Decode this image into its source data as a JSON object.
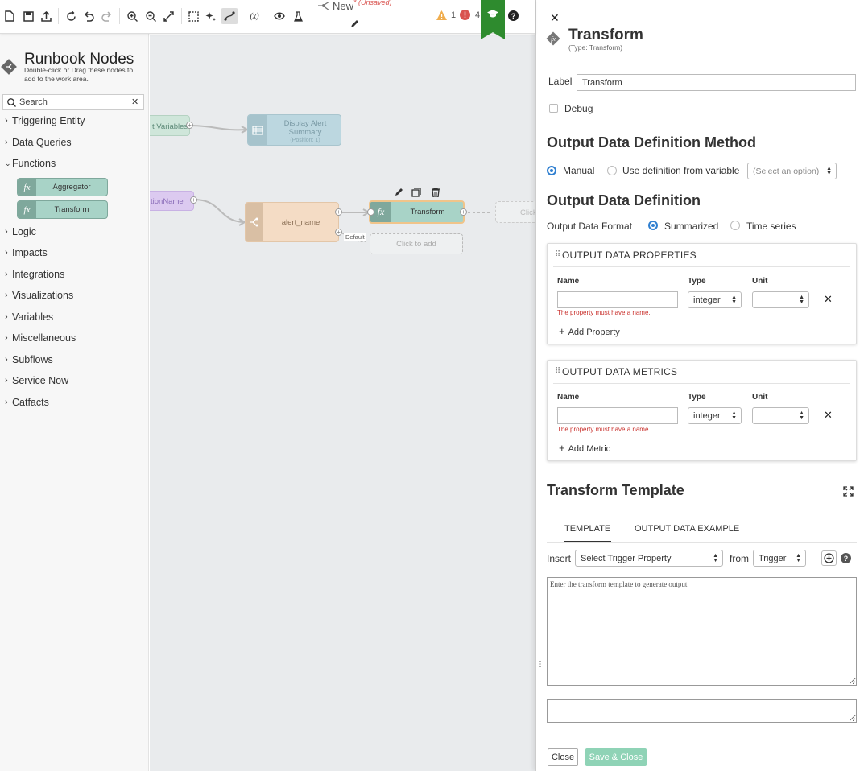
{
  "toolbar": {
    "flow_title": "New",
    "unsaved_label": "(Unsaved)",
    "warning_count": "1",
    "error_count": "4",
    "warning_color": "#f0ad4e",
    "error_color": "#d9534f",
    "learn_color": "#2e8b2e",
    "icons": [
      "new-file-icon",
      "save-icon",
      "export-icon",
      "refresh-icon",
      "undo-icon",
      "redo-icon",
      "zoom-in-icon",
      "zoom-out-icon",
      "fit-screen-icon",
      "select-area-icon",
      "auto-layout-icon",
      "connector-icon",
      "variables-icon",
      "preview-icon",
      "test-icon",
      "learn-icon",
      "help-icon"
    ]
  },
  "sidebar": {
    "title": "Runbook Nodes",
    "subtitle": "Double-click or Drag these nodes to add to the work area.",
    "search_placeholder": "Search",
    "categories": [
      {
        "label": "Triggering Entity",
        "expanded": false
      },
      {
        "label": "Data Queries",
        "expanded": false
      },
      {
        "label": "Functions",
        "expanded": true
      },
      {
        "label": "Logic",
        "expanded": false
      },
      {
        "label": "Impacts",
        "expanded": false
      },
      {
        "label": "Integrations",
        "expanded": false
      },
      {
        "label": "Visualizations",
        "expanded": false
      },
      {
        "label": "Variables",
        "expanded": false
      },
      {
        "label": "Miscellaneous",
        "expanded": false
      },
      {
        "label": "Subflows",
        "expanded": false
      },
      {
        "label": "Service Now",
        "expanded": false
      },
      {
        "label": "Catfacts",
        "expanded": false
      }
    ],
    "function_nodes": [
      {
        "label": "Aggregator",
        "icon": "fx"
      },
      {
        "label": "Transform",
        "icon": "fx"
      }
    ]
  },
  "canvas": {
    "nodes": {
      "set_variables": "t Variables",
      "display_alert_title": "Display Alert Summary",
      "display_alert_sub": "(Position: 1)",
      "condition_name": "tionName",
      "alert_name": "alert_name",
      "transform": "Transform",
      "click_to_add": "Click to add",
      "click_to_add_partial": "Click",
      "default_label": "Default"
    }
  },
  "panel": {
    "title": "Transform",
    "type_label": "(Type: Transform)",
    "label_field_label": "Label",
    "label_field_value": "Transform",
    "debug_label": "Debug",
    "method_heading": "Output Data Definition Method",
    "method_manual": "Manual",
    "method_variable": "Use definition from variable",
    "method_variable_select": "(Select an option)",
    "definition_heading": "Output Data Definition",
    "format_label": "Output Data Format",
    "format_summarized": "Summarized",
    "format_timeseries": "Time series",
    "properties_card": {
      "title": "OUTPUT DATA PROPERTIES",
      "col_name": "Name",
      "col_type": "Type",
      "col_unit": "Unit",
      "name_value": "",
      "type_value": "integer",
      "unit_value": "",
      "error": "The property must have a name.",
      "add_label": "Add Property"
    },
    "metrics_card": {
      "title": "OUTPUT DATA METRICS",
      "col_name": "Name",
      "col_type": "Type",
      "col_unit": "Unit",
      "name_value": "",
      "type_value": "integer",
      "unit_value": "",
      "error": "The property must have a name.",
      "add_label": "Add Metric"
    },
    "template_heading": "Transform Template",
    "tabs": [
      {
        "label": "TEMPLATE",
        "active": true
      },
      {
        "label": "OUTPUT DATA EXAMPLE",
        "active": false
      }
    ],
    "insert_label": "Insert",
    "insert_select": "Select Trigger Property",
    "from_label": "from",
    "from_select": "Trigger",
    "template_placeholder": "Enter the transform template to generate output",
    "close_button": "Close",
    "save_close_button": "Save & Close",
    "save_color": "#8fd3b6"
  }
}
